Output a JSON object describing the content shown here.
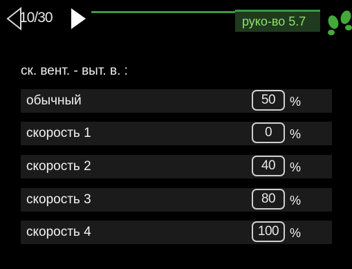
{
  "header": {
    "page_counter": "10/30",
    "menu_label": "руко-во 5.7",
    "back_icon": "back-arrow-icon",
    "forward_icon": "forward-arrow-icon",
    "status_icon": "footsteps-icon"
  },
  "section": {
    "title": "ск. вент. - выт. в. :"
  },
  "rows": [
    {
      "label": "обычный",
      "value": "50",
      "unit": "%"
    },
    {
      "label": "скорость 1",
      "value": "0",
      "unit": "%"
    },
    {
      "label": "скорость 2",
      "value": "40",
      "unit": "%"
    },
    {
      "label": "скорость 3",
      "value": "80",
      "unit": "%"
    },
    {
      "label": "скорость 4",
      "value": "100",
      "unit": "%"
    }
  ],
  "colors": {
    "accent_green": "#3a9a44",
    "badge_text": "#8ee06a",
    "row_background": "#1b1b1b"
  }
}
